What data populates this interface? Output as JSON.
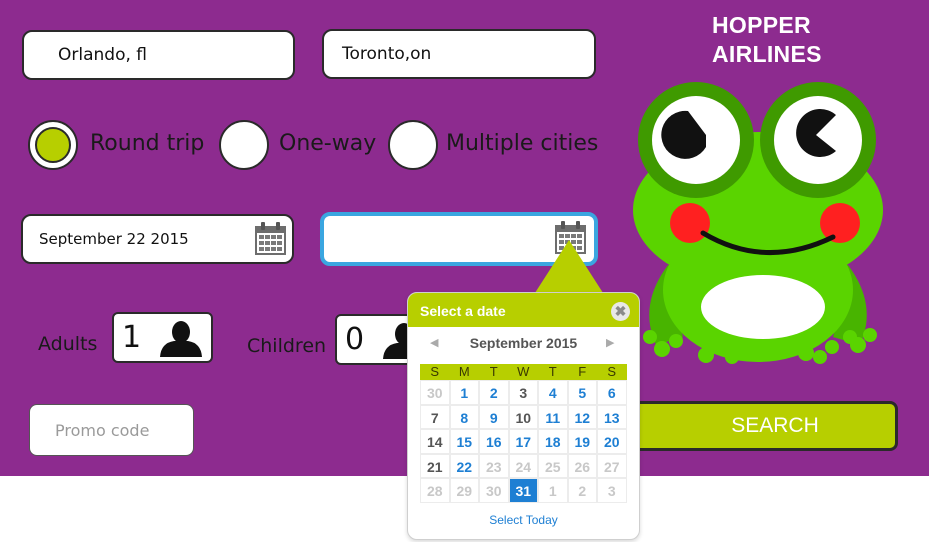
{
  "brand": {
    "line1": "HOPPER",
    "line2": "AIRLINES"
  },
  "from": {
    "value": "Orlando, fl"
  },
  "to": {
    "value": "Toronto,on"
  },
  "trip": {
    "options": [
      {
        "label": "Round trip",
        "selected": true
      },
      {
        "label": "One-way",
        "selected": false
      },
      {
        "label": "Multiple cities",
        "selected": false
      }
    ]
  },
  "depart": {
    "value": "September 22 2015",
    "icon": "calendar-icon"
  },
  "return": {
    "value": "",
    "icon": "calendar-icon"
  },
  "passengers": {
    "adults_label": "Adults",
    "adults_value": "1",
    "children_label": "Children",
    "children_value": "0",
    "icon": "person-icon"
  },
  "promo": {
    "placeholder": "Promo code"
  },
  "search": {
    "label": "SEARCH"
  },
  "calendar": {
    "header": "Select a date",
    "close": "✖",
    "month": "September 2015",
    "prev": "◀",
    "next": "▶",
    "weekdays": [
      "S",
      "M",
      "T",
      "W",
      "T",
      "F",
      "S"
    ],
    "weeks": [
      [
        "30",
        "1",
        "2",
        "3",
        "4",
        "5",
        "6"
      ],
      [
        "7",
        "8",
        "9",
        "10",
        "11",
        "12",
        "13"
      ],
      [
        "14",
        "15",
        "16",
        "17",
        "18",
        "19",
        "20"
      ],
      [
        "21",
        "22",
        "23",
        "24",
        "25",
        "26",
        "27"
      ],
      [
        "28",
        "29",
        "30",
        "31",
        "1",
        "2",
        "3"
      ]
    ],
    "selected_day": "31",
    "footer": "Select Today"
  },
  "colors": {
    "panel": "#8d2b8f",
    "accent": "#b7cf00",
    "focus": "#3aa6e0",
    "calendar_link": "#1e7fd3"
  },
  "mascot": {
    "icon": "frog-mascot-icon"
  }
}
